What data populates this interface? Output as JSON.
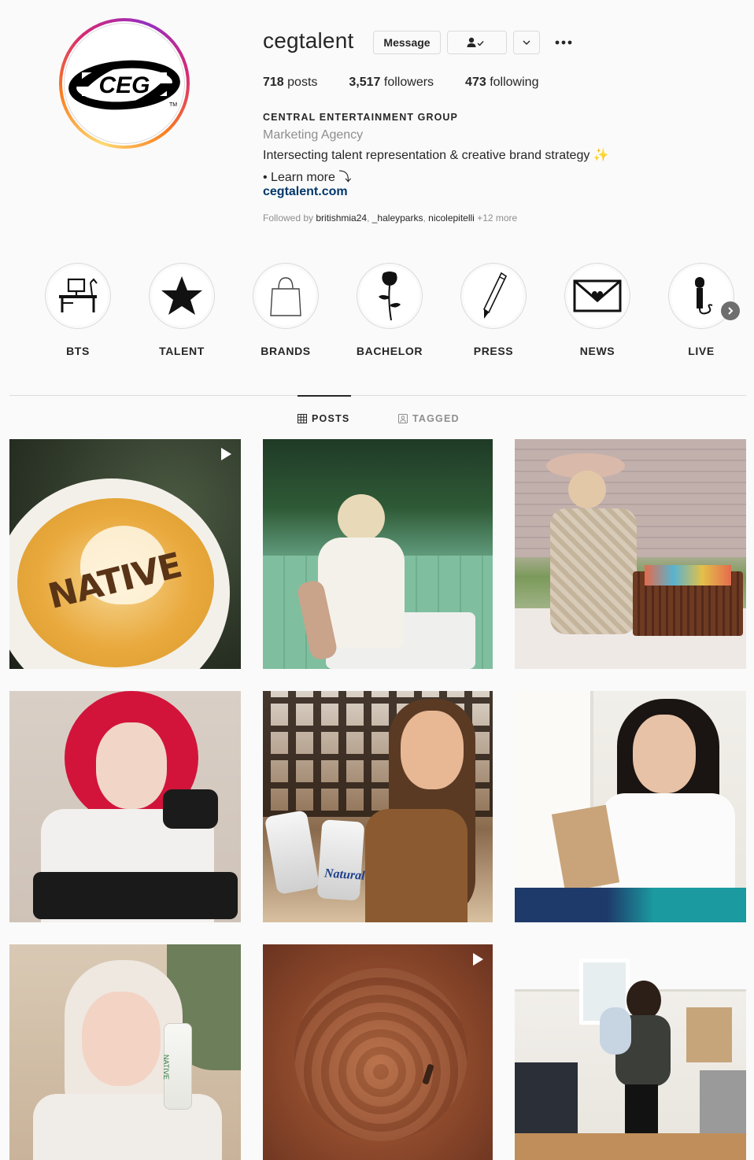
{
  "profile": {
    "username": "cegtalent",
    "avatar_text": "CEG",
    "message_label": "Message",
    "posts_count": "718",
    "posts_label": "posts",
    "followers_count": "3,517",
    "followers_label": "followers",
    "following_count": "473",
    "following_label": "following",
    "full_name": "CENTRAL ENTERTAINMENT GROUP",
    "category": "Marketing Agency",
    "bio_line1": "Intersecting talent representation & creative brand strategy ✨",
    "bio_line2": "• Learn more ⤵",
    "website": "cegtalent.com",
    "followed_prefix": "Followed by",
    "followed_user1": "britishmia24",
    "followed_user2": "_haleyparks",
    "followed_user3": "nicolepitelli",
    "followed_more": "+12 more"
  },
  "highlights": [
    {
      "label": "BTS",
      "icon": "desk-icon"
    },
    {
      "label": "TALENT",
      "icon": "star-icon"
    },
    {
      "label": "BRANDS",
      "icon": "shopping-bag-icon"
    },
    {
      "label": "BACHELOR",
      "icon": "rose-icon"
    },
    {
      "label": "PRESS",
      "icon": "pencil-icon"
    },
    {
      "label": "NEWS",
      "icon": "envelope-heart-icon"
    },
    {
      "label": "LIVE",
      "icon": "microphone-icon"
    }
  ],
  "tabs": {
    "posts": "POSTS",
    "tagged": "TAGGED"
  },
  "posts": [
    {
      "text": "NATIVE",
      "video": true
    },
    {
      "video": false
    },
    {
      "video": false
    },
    {
      "video": false
    },
    {
      "text": "Natural",
      "video": false
    },
    {
      "video": false
    },
    {
      "text": "NATIVE",
      "video": false
    },
    {
      "video": true
    },
    {
      "video": false
    }
  ],
  "colors": {
    "link": "#00376b",
    "muted": "#8e8e8e",
    "border": "#dbdbdb",
    "background": "#fafafa"
  }
}
